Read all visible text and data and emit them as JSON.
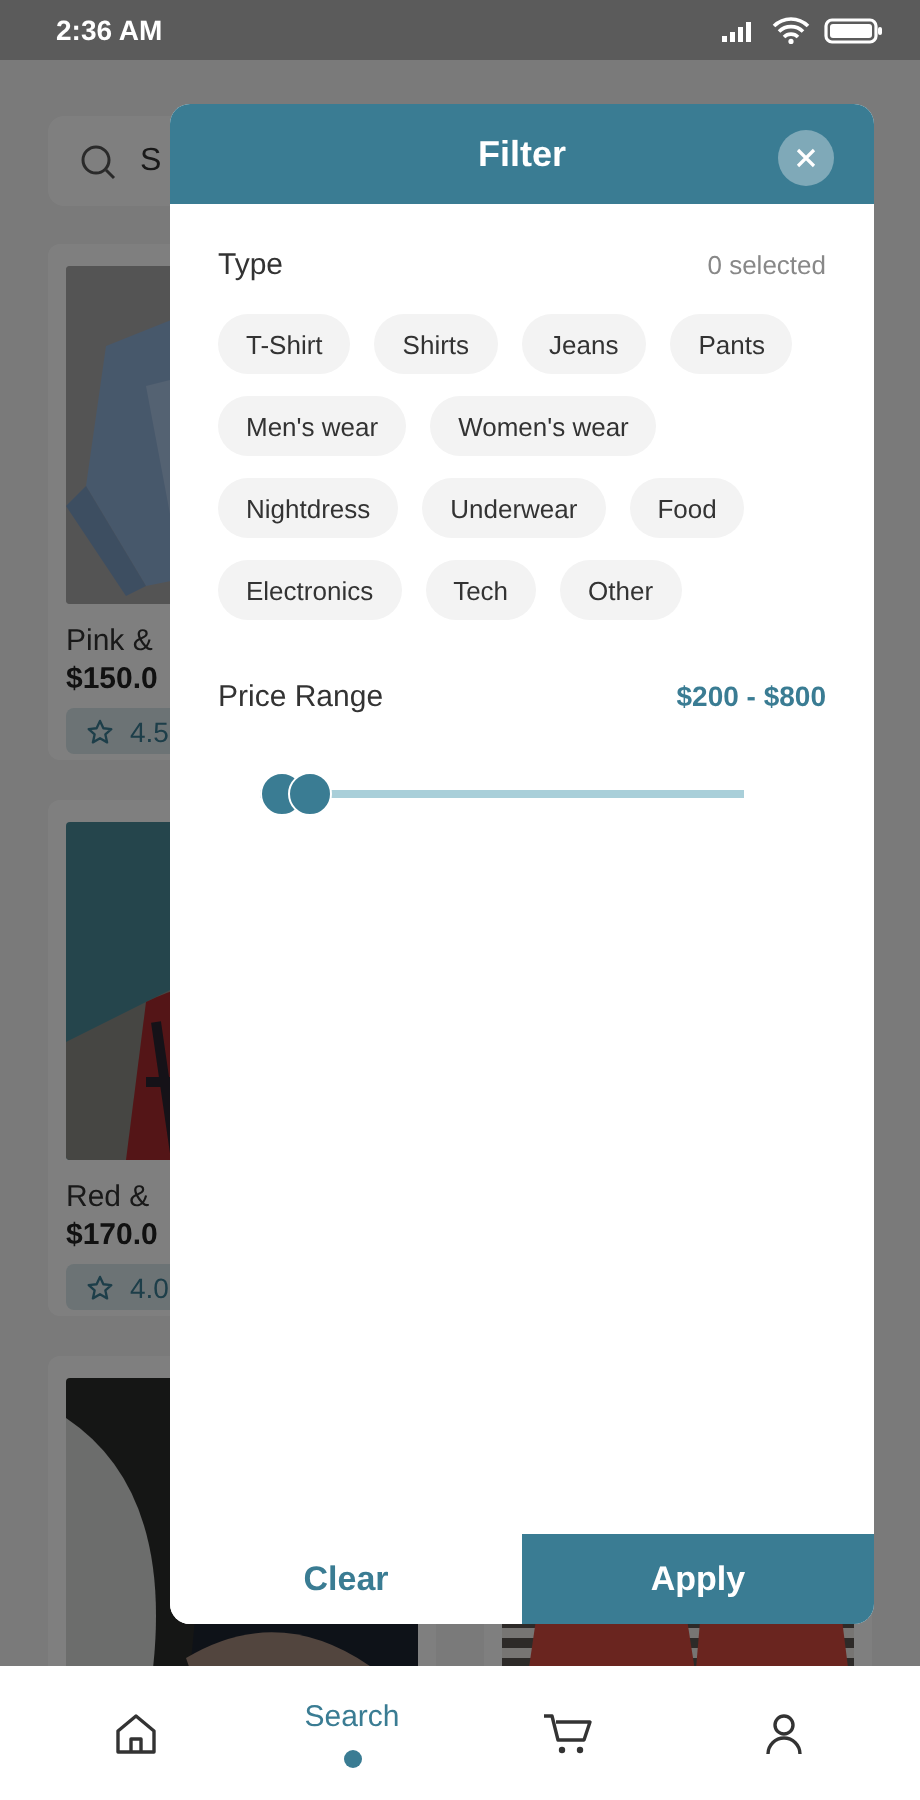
{
  "status_bar": {
    "time": "2:36 AM"
  },
  "search": {
    "placeholder": "S"
  },
  "products": [
    {
      "name": "Pink &",
      "price": "$150.0",
      "rating": "4.5"
    },
    {
      "name": "Red &",
      "price": "$170.0",
      "rating": "4.0"
    }
  ],
  "filter": {
    "title": "Filter",
    "type_label": "Type",
    "selected_count": "0 selected",
    "types": [
      {
        "label": "T-Shirt",
        "selected": false
      },
      {
        "label": "Shirts",
        "selected": false
      },
      {
        "label": "Jeans",
        "selected": false
      },
      {
        "label": "Pants",
        "selected": false
      },
      {
        "label": "Men's wear",
        "selected": false
      },
      {
        "label": "Women's wear",
        "selected": false
      },
      {
        "label": "Nightdress",
        "selected": false
      },
      {
        "label": "Underwear",
        "selected": false
      },
      {
        "label": "Food",
        "selected": false
      },
      {
        "label": "Electronics",
        "selected": false
      },
      {
        "label": "Tech",
        "selected": false
      },
      {
        "label": "Other",
        "selected": false
      }
    ],
    "price_label": "Price Range",
    "price_value": "$200 - $800",
    "price_slider": {
      "low": {
        "level": 0
      },
      "high": {
        "level": 0.065
      }
    },
    "buttons": [
      {
        "kind": "secondary",
        "label": "Clear"
      },
      {
        "kind": "primary",
        "label": "Apply"
      }
    ]
  },
  "nav": [
    {
      "selected": false
    },
    {
      "label": "Search",
      "selected": true
    },
    {
      "selected": false
    },
    {
      "selected": false
    }
  ]
}
